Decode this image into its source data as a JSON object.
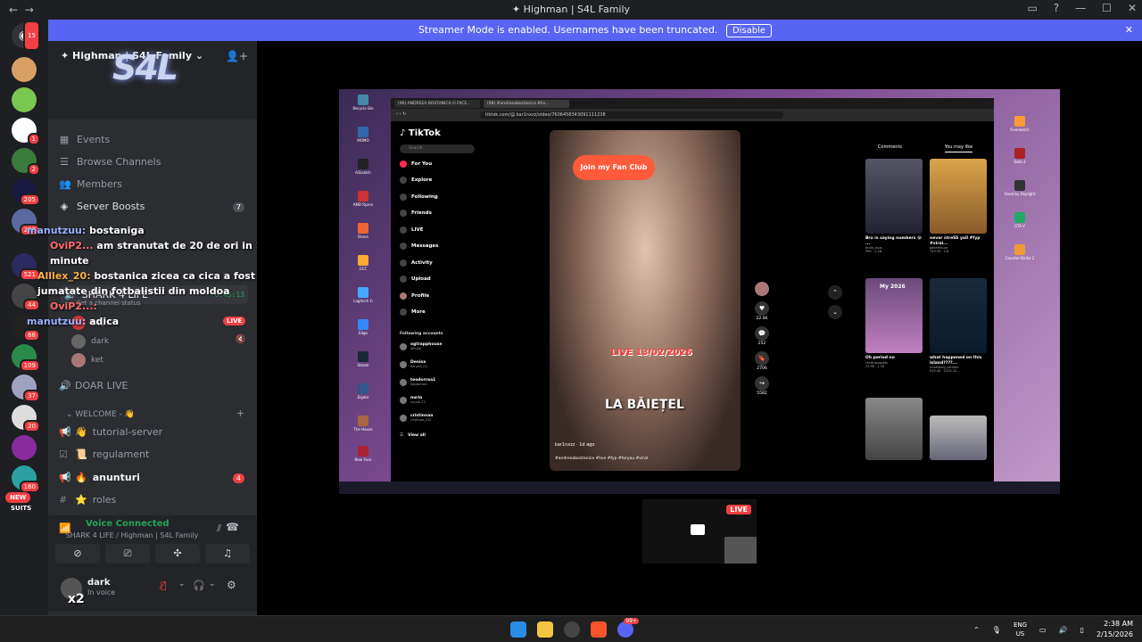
{
  "window": {
    "title": "Highman | S4L Family",
    "nav_back": "←",
    "nav_fwd": "→"
  },
  "banner": {
    "text": "Streamer Mode is enabled. Usernames have been truncated.",
    "button": "Disable",
    "close": "✕"
  },
  "server_rail": {
    "badges": [
      "15",
      "1",
      "2",
      "205",
      "228",
      "521",
      "44",
      "68",
      "109",
      "37",
      "20",
      "160"
    ],
    "new_label": "NEW",
    "suits_label": "SUITS"
  },
  "server": {
    "name": "Highman | S4L Family",
    "logo": "S4L"
  },
  "menu": [
    {
      "label": "Events",
      "icon": "calendar-icon"
    },
    {
      "label": "Browse Channels",
      "icon": "browse-icon"
    },
    {
      "label": "Members",
      "icon": "members-icon"
    },
    {
      "label": "Server Boosts",
      "icon": "boost-icon",
      "count": "7"
    }
  ],
  "channels": {
    "voice_main": {
      "name": "SHARK 4 LIFE",
      "timer": "6:48:13",
      "status": "Set a channel status"
    },
    "voice_users": [
      {
        "name": "S4L",
        "live": "LIVE"
      },
      {
        "name": "dark"
      },
      {
        "name": "ket"
      }
    ],
    "doar_live": "DOAR LIVE",
    "category": "WELCOME - 👋",
    "text_channels": [
      {
        "name": "tutorial-server",
        "emoji": "👋"
      },
      {
        "name": "regulament",
        "emoji": "📜"
      },
      {
        "name": "anunturi",
        "emoji": "🔥",
        "mention": "4"
      },
      {
        "name": "roles",
        "emoji": "⭐"
      }
    ]
  },
  "chat_overlay": [
    {
      "nick": "manutzuu:",
      "text": "bostaniga"
    },
    {
      "nick": "OviP2...",
      "text": "am stranutat de 20 de ori in 10 minute"
    },
    {
      "nick": "Alllex_20:",
      "text": "bostanica zicea ca cica a fost cu jumatate din fotbalistii din moldoa"
    },
    {
      "nick": "OviP2...:",
      "text": ""
    },
    {
      "nick": "manutzuu:",
      "text": "adica"
    }
  ],
  "voice_connected": {
    "title": "Voice Connected",
    "subtitle": "SHARK 4 LIFE / Highman | S4L Family"
  },
  "user_panel": {
    "name": "dark",
    "status": "In voice",
    "badge": "x2"
  },
  "stream": {
    "tabs": [
      "(96) ANDREEA BOSTANICA O FACE...",
      "(99) #andreeabostanica #liv..."
    ],
    "url": "tiktok.com/@.kar1nxzz/video/7606458343091111238",
    "tiktok": {
      "logo": "TikTok",
      "search": "Search",
      "nav": [
        "For You",
        "Explore",
        "Following",
        "Friends",
        "LIVE",
        "Messages",
        "Activity",
        "Upload",
        "Profile",
        "More"
      ],
      "following_title": "Following accounts",
      "accounts": [
        {
          "name": "ogtrapphouse",
          "sub": "affollie"
        },
        {
          "name": "Denisa",
          "sub": "denysa_02_"
        },
        {
          "name": "teodorraa1",
          "sub": "teodorraa1"
        },
        {
          "name": "nuria",
          "sub": "nouria.23"
        },
        {
          "name": "cristinnaa",
          "sub": "cristinaa_015"
        }
      ],
      "view_all": "View all"
    },
    "video": {
      "fan_club": "Join my Fan Club",
      "live_text": "LIVE 13/02/2026",
      "caption": "LA BĂIEȚEL",
      "user": "kar1nxzz · 1d ago",
      "tags": "#andreeabostanica #live #fyp #foryou #viral"
    },
    "actions": [
      "22.4K",
      "252",
      "2706",
      "5582"
    ],
    "right_tabs": [
      "Comments",
      "You may like"
    ],
    "thumbs": [
      {
        "title": "Bro is saying numbers 😭 ...",
        "user": "drilla_clips",
        "meta": "560 · 1-28"
      },
      {
        "title": "never streSS yall #fyp #viral...",
        "user": "gabemhuzz",
        "meta": "743.7K · 2-6"
      },
      {
        "title": "Oh period no",
        "user": "christianapitts",
        "meta": "23.9K · 1-30"
      },
      {
        "title": "what happened on this island????...",
        "user": "unsettling_content",
        "meta": "925.4K · 2025-12..."
      }
    ],
    "thumb_overlay": "My 2026"
  },
  "pip": {
    "live": "LIVE"
  },
  "taskbar": {
    "lang_top": "ENG",
    "lang_bottom": "US",
    "time": "2:38 AM",
    "date": "2/15/2026",
    "discord_badge": "99+"
  }
}
